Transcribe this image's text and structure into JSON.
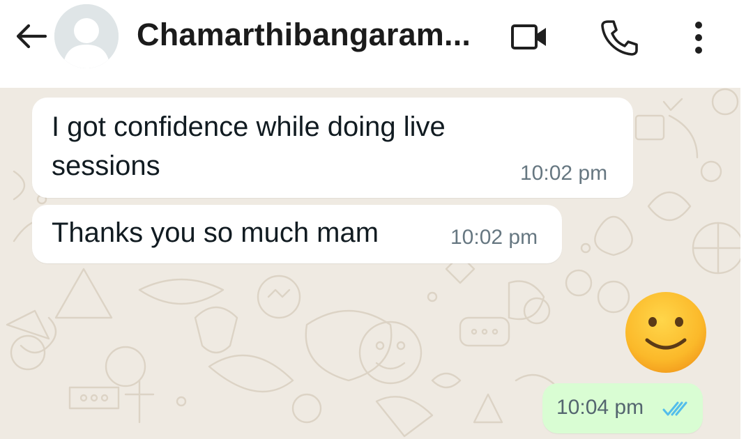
{
  "header": {
    "contact_name": "Chamarthibangaram...",
    "back_icon": "arrow-left-icon",
    "avatar_icon": "default-avatar-icon",
    "video_icon": "video-camera-icon",
    "call_icon": "phone-icon",
    "menu_icon": "more-vertical-icon"
  },
  "chat": {
    "incoming": [
      {
        "text": "I got confidence while doing live sessions",
        "time": "10:02 pm"
      },
      {
        "text": "Thanks you so much mam",
        "time": "10:02 pm"
      }
    ],
    "outgoing": [
      {
        "emoji": "🙂",
        "time": "10:04 pm",
        "status": "read"
      }
    ]
  },
  "colors": {
    "chat_background": "#efeae2",
    "incoming_bubble": "#ffffff",
    "outgoing_bubble": "#d9fdd3",
    "timestamp": "#667781",
    "read_ticks": "#53bdeb"
  }
}
